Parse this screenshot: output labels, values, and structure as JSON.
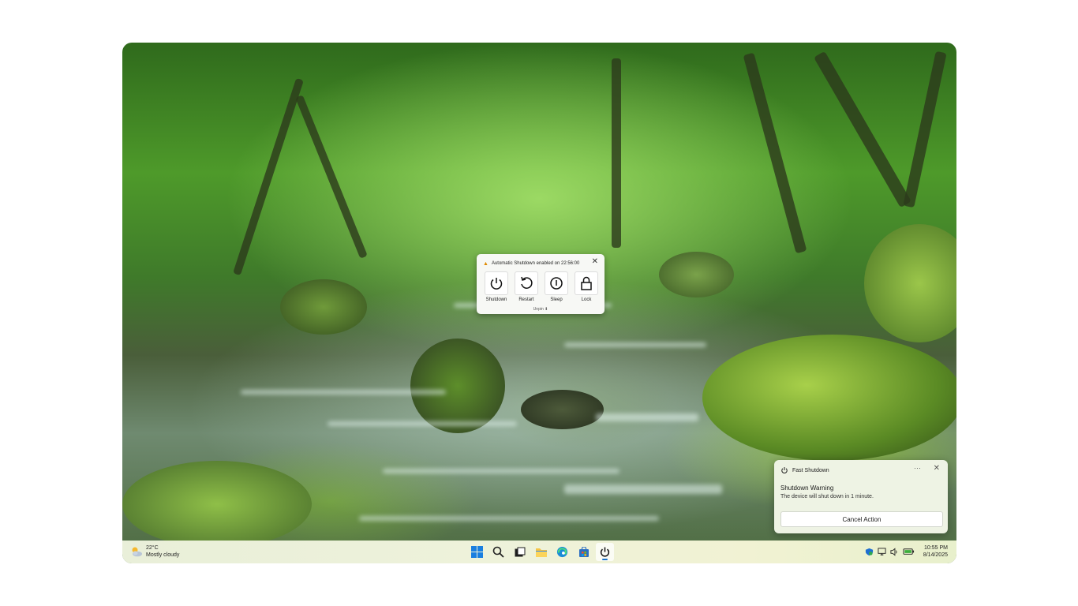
{
  "colors": {
    "warning_accent": "#e08a00",
    "taskbar_active_indicator": "#1b74c9"
  },
  "shutdown_popup": {
    "message": "Automatic Shutdown enabled on 22:56:00",
    "warning_icon": "warning-triangle-icon",
    "actions": [
      {
        "label": "Shutdown",
        "icon": "power-icon"
      },
      {
        "label": "Restart",
        "icon": "restart-icon"
      },
      {
        "label": "Sleep",
        "icon": "sleep-icon"
      },
      {
        "label": "Lock",
        "icon": "lock-icon"
      }
    ],
    "footer": "Unpin ⬇"
  },
  "notification": {
    "app_name": "Fast Shutdown",
    "more_label": "···",
    "title": "Shutdown Warning",
    "body": "The device will shut down in 1 minute.",
    "button": "Cancel Action"
  },
  "taskbar": {
    "weather": {
      "temp": "22°C",
      "condition": "Mostly cloudy",
      "icon": "partly-cloudy-icon"
    },
    "apps": [
      {
        "name": "start",
        "icon": "windows-start-icon"
      },
      {
        "name": "search",
        "icon": "search-icon"
      },
      {
        "name": "task-view",
        "icon": "task-view-icon"
      },
      {
        "name": "file-explorer",
        "icon": "folder-icon"
      },
      {
        "name": "edge",
        "icon": "edge-browser-icon"
      },
      {
        "name": "store",
        "icon": "store-icon"
      },
      {
        "name": "fast-shutdown",
        "icon": "power-icon",
        "active": true
      }
    ],
    "tray_icons": [
      "defender-icon",
      "network-icon",
      "volume-icon",
      "battery-icon"
    ],
    "time": "10:55 PM",
    "date": "8/14/2025"
  }
}
